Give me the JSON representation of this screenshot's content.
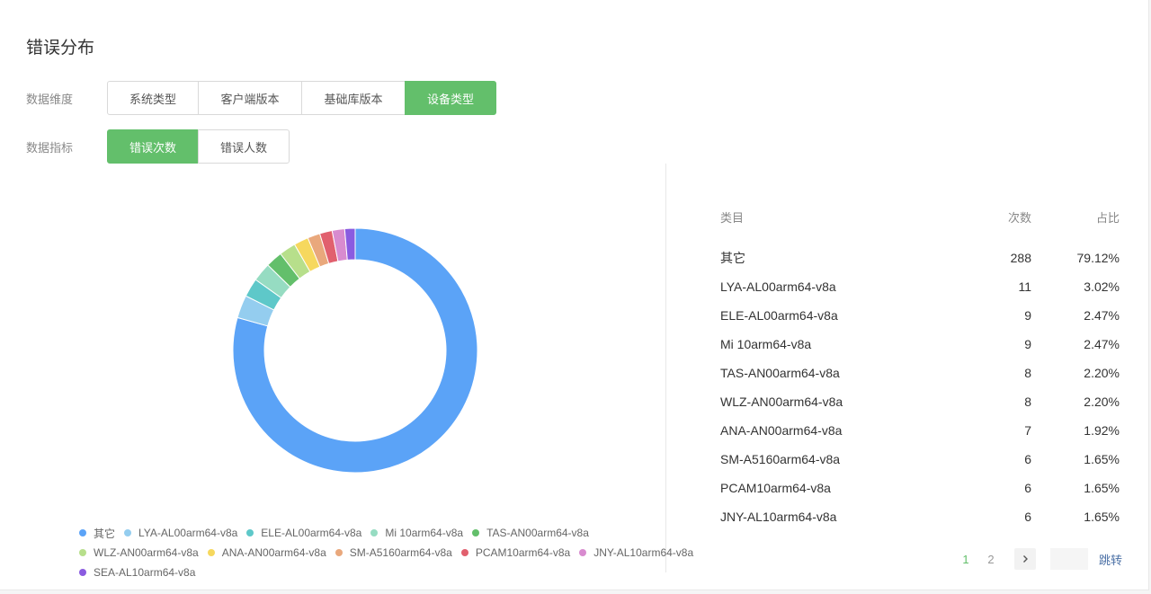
{
  "title": "错误分布",
  "dimension": {
    "label": "数据维度",
    "options": [
      "系统类型",
      "客户端版本",
      "基础库版本",
      "设备类型"
    ],
    "active_index": 3
  },
  "metric": {
    "label": "数据指标",
    "options": [
      "错误次数",
      "错误人数"
    ],
    "active_index": 0
  },
  "chart_data": {
    "type": "pie",
    "donut": true,
    "series": [
      {
        "name": "其它",
        "value": 288,
        "color": "#5ba3f7"
      },
      {
        "name": "LYA-AL00arm64-v8a",
        "value": 11,
        "color": "#94cdef"
      },
      {
        "name": "ELE-AL00arm64-v8a",
        "value": 9,
        "color": "#5ec8c9"
      },
      {
        "name": "Mi 10arm64-v8a",
        "value": 9,
        "color": "#96dcc2"
      },
      {
        "name": "TAS-AN00arm64-v8a",
        "value": 8,
        "color": "#63bf6b"
      },
      {
        "name": "WLZ-AN00arm64-v8a",
        "value": 8,
        "color": "#b7df8b"
      },
      {
        "name": "ANA-AN00arm64-v8a",
        "value": 7,
        "color": "#f6d85e"
      },
      {
        "name": "SM-A5160arm64-v8a",
        "value": 6,
        "color": "#e9a87c"
      },
      {
        "name": "PCAM10arm64-v8a",
        "value": 6,
        "color": "#e1606e"
      },
      {
        "name": "JNY-AL10arm64-v8a",
        "value": 6,
        "color": "#d88bcf"
      },
      {
        "name": "SEA-AL10arm64-v8a",
        "value": 5,
        "color": "#8a5be0"
      }
    ]
  },
  "table": {
    "headers": {
      "name": "类目",
      "count": "次数",
      "pct": "占比"
    },
    "rows": [
      {
        "name": "其它",
        "count": "288",
        "pct": "79.12%"
      },
      {
        "name": "LYA-AL00arm64-v8a",
        "count": "11",
        "pct": "3.02%"
      },
      {
        "name": "ELE-AL00arm64-v8a",
        "count": "9",
        "pct": "2.47%"
      },
      {
        "name": "Mi 10arm64-v8a",
        "count": "9",
        "pct": "2.47%"
      },
      {
        "name": "TAS-AN00arm64-v8a",
        "count": "8",
        "pct": "2.20%"
      },
      {
        "name": "WLZ-AN00arm64-v8a",
        "count": "8",
        "pct": "2.20%"
      },
      {
        "name": "ANA-AN00arm64-v8a",
        "count": "7",
        "pct": "1.92%"
      },
      {
        "name": "SM-A5160arm64-v8a",
        "count": "6",
        "pct": "1.65%"
      },
      {
        "name": "PCAM10arm64-v8a",
        "count": "6",
        "pct": "1.65%"
      },
      {
        "name": "JNY-AL10arm64-v8a",
        "count": "6",
        "pct": "1.65%"
      }
    ]
  },
  "pagination": {
    "pages": [
      "1",
      "2"
    ],
    "current": "1",
    "next_icon": "chevron-right-icon",
    "jump_label": "跳转"
  },
  "colors": {
    "accent": "#63bf6b"
  }
}
